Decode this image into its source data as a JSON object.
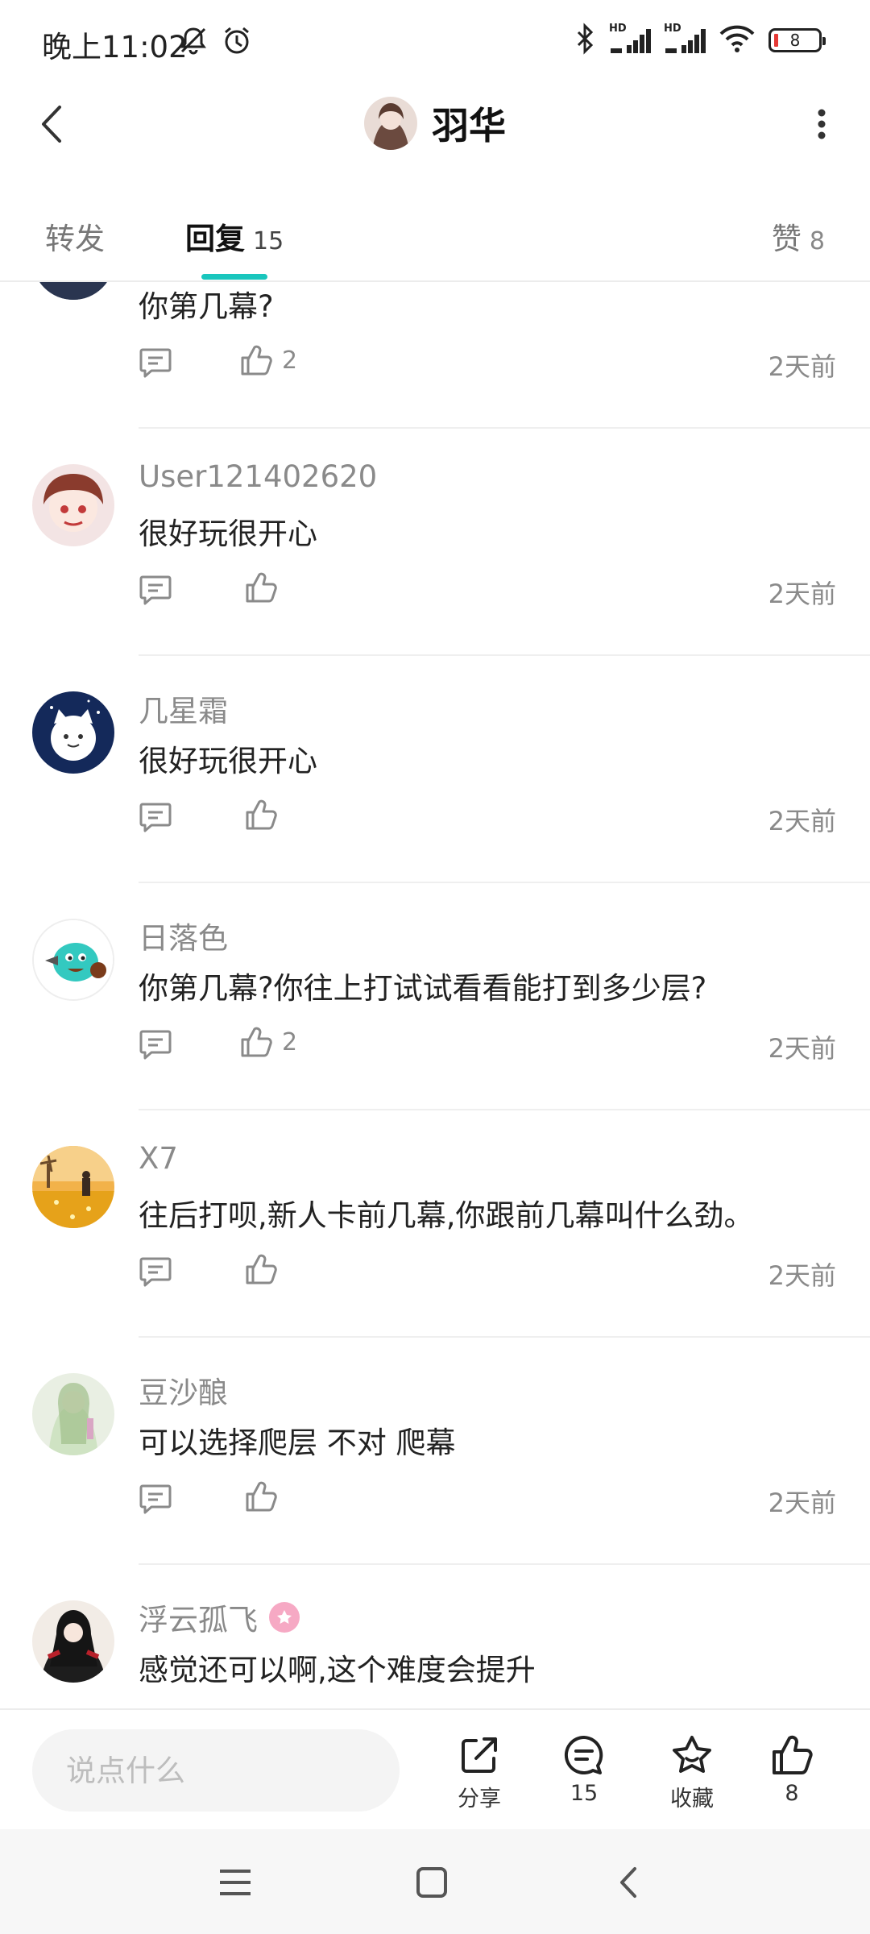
{
  "status_bar": {
    "time": "晚上11:02",
    "battery_level": "8"
  },
  "header": {
    "title": "羽华"
  },
  "tabs": [
    {
      "label": "转发",
      "count": ""
    },
    {
      "label": "回复",
      "count": "15"
    },
    {
      "label": "赞",
      "count": "8"
    }
  ],
  "comments": [
    {
      "name": "",
      "text": "你第几幕?",
      "likes": "2",
      "time": "2天前"
    },
    {
      "name": "User121402620",
      "text": "很好玩很开心",
      "likes": "",
      "time": "2天前"
    },
    {
      "name": "几星霜",
      "text": "很好玩很开心",
      "likes": "",
      "time": "2天前"
    },
    {
      "name": "日落色",
      "text": "你第几幕?你往上打试试看看能打到多少层?",
      "likes": "2",
      "time": "2天前"
    },
    {
      "name": "X7",
      "text": "往后打呗,新人卡前几幕,你跟前几幕叫什么劲。",
      "likes": "",
      "time": "2天前"
    },
    {
      "name": "豆沙酿",
      "text": "可以选择爬层 不对 爬幕",
      "likes": "",
      "time": "2天前"
    },
    {
      "name": "浮云孤飞",
      "text": "感觉还可以啊,这个难度会提升",
      "likes": "",
      "time": ""
    }
  ],
  "bottom_bar": {
    "input_placeholder": "说点什么",
    "share_label": "分享",
    "comment_count": "15",
    "favorite_label": "收藏",
    "like_count": "8"
  },
  "colors": {
    "accent": "#19c6bd",
    "secondary_text": "#8a8a8a",
    "primary_text": "#222222"
  }
}
